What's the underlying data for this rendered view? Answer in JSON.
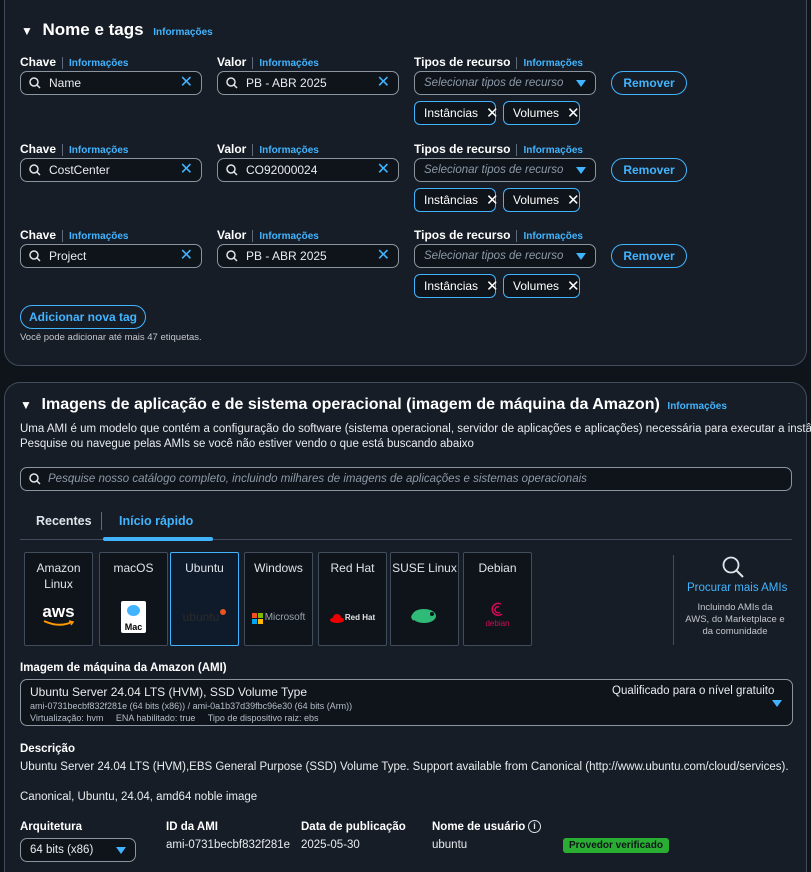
{
  "tags_section": {
    "title": "Nome e tags",
    "info": "Informações",
    "key_label": "Chave",
    "value_label": "Valor",
    "resource_label": "Tipos de recurso",
    "resource_placeholder": "Selecionar tipos de recurso",
    "remove_label": "Remover",
    "rows": [
      {
        "key": "Name",
        "value": "PB - ABR 2025",
        "tokens": [
          "Instâncias",
          "Volumes"
        ]
      },
      {
        "key": "CostCenter",
        "value": "CO92000024",
        "tokens": [
          "Instâncias",
          "Volumes"
        ]
      },
      {
        "key": "Project",
        "value": "PB - ABR 2025",
        "tokens": [
          "Instâncias",
          "Volumes"
        ]
      }
    ],
    "add_tag_label": "Adicionar nova tag",
    "limit_text": "Você pode adicionar até mais 47 etiquetas."
  },
  "ami_section": {
    "title": "Imagens de aplicação e de sistema operacional (imagem de máquina da Amazon)",
    "info": "Informações",
    "description_line1": "Uma AMI é um modelo que contém a configuração do software (sistema operacional, servidor de aplicações e aplicações) necessária para executar a instância.",
    "description_line2": "Pesquise ou navegue pelas AMIs se você não estiver vendo o que está buscando abaixo",
    "search_placeholder": "Pesquise nosso catálogo completo, incluindo milhares de imagens de aplicações e sistemas operacionais",
    "tabs": [
      "Recentes",
      "Início rápido"
    ],
    "os_tiles": [
      "Amazon Linux",
      "macOS",
      "Ubuntu",
      "Windows",
      "Red Hat",
      "SUSE Linux",
      "Debian"
    ],
    "logo_texts": {
      "aws": "aws",
      "mac": "Mac",
      "ubuntu": "ubuntu",
      "microsoft": "Microsoft",
      "redhat": "Red Hat",
      "debian": "debian"
    },
    "browse_more": {
      "title": "Procurar mais AMIs",
      "sub1": "Incluindo AMIs da",
      "sub2": "AWS, do Marketplace e",
      "sub3": "da comunidade"
    },
    "ami_label": "Imagem de máquina da Amazon (AMI)",
    "ami_name": "Ubuntu Server 24.04 LTS (HVM), SSD Volume Type",
    "ami_ids": "ami-0731becbf832f281e (64 bits (x86)) / ami-0a1b37d39fbc96e30 (64 bits (Arm))",
    "ami_meta": "Virtualização: hvm     ENA habilitado: true     Tipo de dispositivo raiz: ebs",
    "free_tier": "Qualificado para o nível gratuito",
    "desc_label": "Descrição",
    "desc_text": "Ubuntu Server 24.04 LTS (HVM),EBS General Purpose (SSD) Volume Type. Support available from Canonical (http://www.ubuntu.com/cloud/services).",
    "desc_tags": "Canonical, Ubuntu, 24.04, amd64 noble image",
    "arch_label": "Arquitetura",
    "arch_value": "64 bits (x86)",
    "ami_id_label": "ID da AMI",
    "ami_id_value": "ami-0731becbf832f281e",
    "pub_label": "Data de publicação",
    "pub_value": "2025-05-30",
    "user_label": "Nome de usuário",
    "user_value": "ubuntu",
    "verified": "Provedor verificado"
  },
  "colors": {
    "accent": "#42b4ff",
    "panel": "#161d26",
    "bg": "#0f141a",
    "badge": "#29ad32"
  }
}
